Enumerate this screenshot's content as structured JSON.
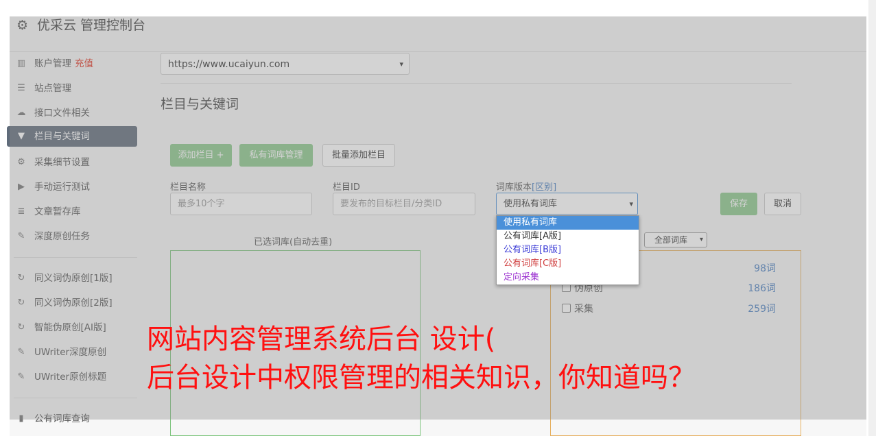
{
  "header": {
    "gear_icon": "gear-icon",
    "title": "优采云 管理控制台"
  },
  "sidebar": {
    "group1": [
      {
        "label": "账户管理",
        "extra": "充值",
        "icon": "bar-chart-icon",
        "icon_glyph": "▥"
      },
      {
        "label": "站点管理",
        "icon": "server-icon",
        "icon_glyph": "☰"
      },
      {
        "label": "接口文件相关",
        "icon": "cloud-upload-icon",
        "icon_glyph": "☁"
      },
      {
        "label": "栏目与关键词",
        "icon": "filter-icon",
        "icon_glyph": "▼",
        "active": true
      },
      {
        "label": "采集细节设置",
        "icon": "cogs-icon",
        "icon_glyph": "⚙"
      },
      {
        "label": "手动运行测试",
        "icon": "play-circle-icon",
        "icon_glyph": "▶"
      },
      {
        "label": "文章暂存库",
        "icon": "database-icon",
        "icon_glyph": "≣"
      },
      {
        "label": "深度原创任务",
        "icon": "edit-icon",
        "icon_glyph": "✎"
      }
    ],
    "group2": [
      {
        "label": "同义词伪原创[1版]",
        "icon": "refresh-icon",
        "icon_glyph": "↻"
      },
      {
        "label": "同义词伪原创[2版]",
        "icon": "refresh-icon",
        "icon_glyph": "↻"
      },
      {
        "label": "智能伪原创[AI版]",
        "icon": "refresh-icon",
        "icon_glyph": "↻"
      },
      {
        "label": "UWriter深度原创",
        "icon": "edit-icon",
        "icon_glyph": "✎"
      },
      {
        "label": "UWriter原创标题",
        "icon": "edit-icon",
        "icon_glyph": "✎"
      }
    ],
    "group3": [
      {
        "label": "公有词库查询",
        "icon": "book-icon",
        "icon_glyph": "▮"
      }
    ]
  },
  "main": {
    "site_select": "https://www.ucaiyun.com",
    "section_title": "栏目与关键词",
    "buttons": {
      "add_column": "添加栏目 +",
      "private_lib": "私有词库管理",
      "batch_add": "批量添加栏目"
    },
    "form": {
      "name_label": "栏目名称",
      "name_placeholder": "最多10个字",
      "id_label": "栏目ID",
      "id_placeholder": "要发布的目标栏目/分类ID",
      "lib_label": "词库版本",
      "lib_link": "[区别]",
      "lib_value": "使用私有词库",
      "save": "保存",
      "cancel": "取消"
    },
    "lib_options": [
      "使用私有词库",
      "公有词库[A版]",
      "公有词库[B版]",
      "公有词库[C版]",
      "定向采集"
    ],
    "lib_option_colors": [
      "#ffffff",
      "#333333",
      "#3b3bd6",
      "#d04040",
      "#9b30d0"
    ],
    "selected_panel_title": "已选词库(自动去重)",
    "filter_select": "全部词库",
    "libraries": [
      {
        "name": "",
        "count": "98词"
      },
      {
        "name": "伪原创",
        "count": "186词"
      },
      {
        "name": "采集",
        "count": "259词"
      }
    ]
  },
  "overlay_text": {
    "line1": "网站内容管理系统后台 设计(",
    "line2": "后台设计中权限管理的相关知识，你知道吗？"
  }
}
